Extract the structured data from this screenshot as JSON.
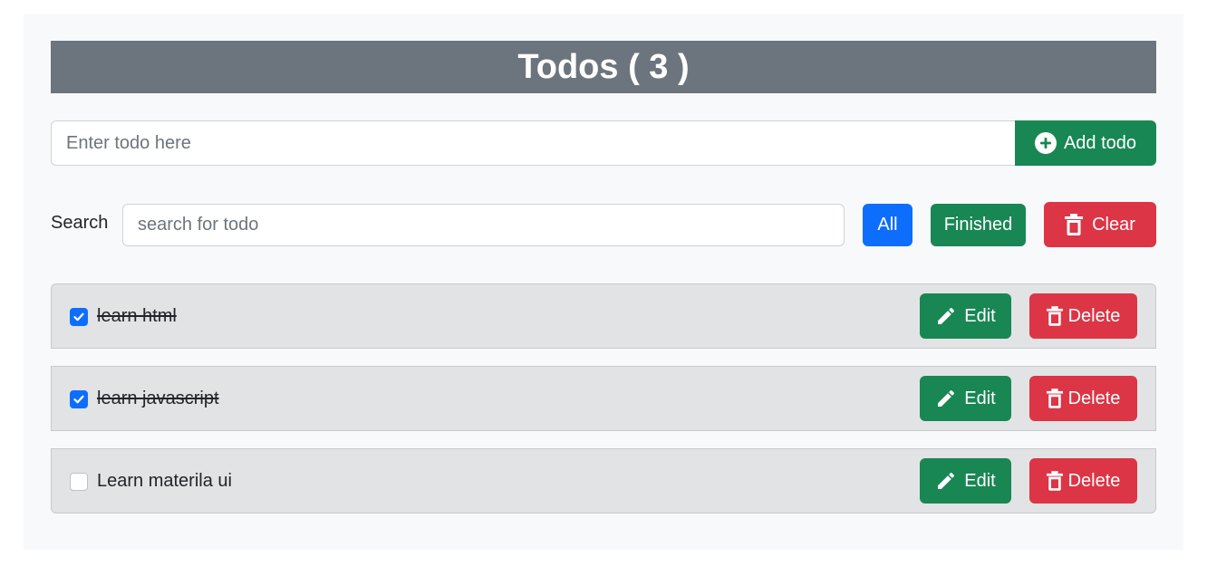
{
  "header": {
    "title": "Todos ( 3 )"
  },
  "add": {
    "placeholder": "Enter todo here",
    "value": "",
    "button_label": "Add todo",
    "button_icon": "plus-circle-icon"
  },
  "search": {
    "label": "Search",
    "placeholder": "search for todo",
    "value": ""
  },
  "filters": {
    "all_label": "All",
    "finished_label": "Finished",
    "clear_label": "Clear",
    "clear_icon": "trash-icon"
  },
  "todos": [
    {
      "text": "learn html",
      "done": true,
      "edit_label": "Edit",
      "delete_label": "Delete"
    },
    {
      "text": "learn javascript",
      "done": true,
      "edit_label": "Edit",
      "delete_label": "Delete"
    },
    {
      "text": "Learn materila ui",
      "done": false,
      "edit_label": "Edit",
      "delete_label": "Delete"
    }
  ],
  "colors": {
    "primary": "#0d6efd",
    "success": "#198754",
    "danger": "#dc3545",
    "secondary": "#6c757d",
    "item_bg": "#e2e3e5",
    "panel_bg": "#f8f9fa"
  }
}
